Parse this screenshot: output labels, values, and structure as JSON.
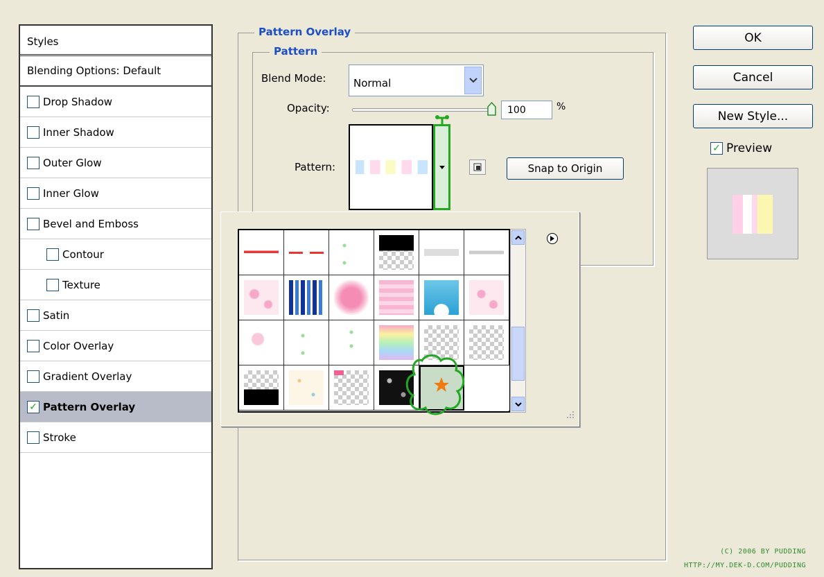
{
  "styles_panel": {
    "header": "Styles",
    "blending": "Blending Options: Default",
    "items": [
      {
        "label": "Drop Shadow",
        "checked": false,
        "indent": false
      },
      {
        "label": "Inner Shadow",
        "checked": false,
        "indent": false
      },
      {
        "label": "Outer Glow",
        "checked": false,
        "indent": false
      },
      {
        "label": "Inner Glow",
        "checked": false,
        "indent": false
      },
      {
        "label": "Bevel and Emboss",
        "checked": false,
        "indent": false
      },
      {
        "label": "Contour",
        "checked": false,
        "indent": true
      },
      {
        "label": "Texture",
        "checked": false,
        "indent": true
      },
      {
        "label": "Satin",
        "checked": false,
        "indent": false
      },
      {
        "label": "Color Overlay",
        "checked": false,
        "indent": false
      },
      {
        "label": "Gradient Overlay",
        "checked": false,
        "indent": false
      },
      {
        "label": "Pattern Overlay",
        "checked": true,
        "indent": false,
        "selected": true
      },
      {
        "label": "Stroke",
        "checked": false,
        "indent": false
      }
    ]
  },
  "pattern_overlay": {
    "group_title": "Pattern Overlay",
    "subgroup_title": "Pattern",
    "blend_mode_label": "Blend Mode:",
    "blend_mode_value": "Normal",
    "opacity_label": "Opacity:",
    "opacity_value": "100",
    "opacity_unit": "%",
    "opacity_level": 1.0,
    "pattern_label": "Pattern:",
    "snap_button": "Snap to Origin"
  },
  "buttons": {
    "ok": "OK",
    "cancel": "Cancel",
    "new_style": "New Style...",
    "preview_label": "Preview",
    "preview_checked": true
  },
  "credit": {
    "line1": "(C) 2006 BY PUDDING",
    "line2": "HTTP://MY.DEK-D.COM/PUDDING"
  },
  "colors": {
    "accent_title": "#1c4fc7",
    "highlight_green": "#22a822",
    "selected_row": "#B8BCC8"
  }
}
